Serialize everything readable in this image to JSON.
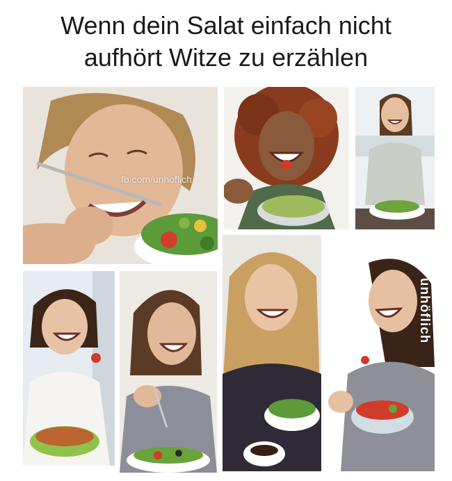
{
  "caption": {
    "line1": "Wenn dein Salat einfach nicht",
    "line2": "aufhört Witze zu erzählen"
  },
  "watermarks": {
    "url": "fb.com/unhoflich",
    "logo": "unhöflich"
  },
  "photos": [
    {
      "id": "photo-1",
      "hair": "#b08a55",
      "skin": "#e2b896",
      "top": "#f3efe9",
      "bg1": "#f1eee9",
      "bg2": "#d9d1c7"
    },
    {
      "id": "photo-2",
      "hair": "#8a3b1e",
      "skin": "#8a5a3c",
      "top": "#4f6b4a",
      "bg1": "#f4f2ef",
      "bg2": "#e0dcd6"
    },
    {
      "id": "photo-3",
      "hair": "#5a3b24",
      "skin": "#e5bfa0",
      "top": "#c9cfc6",
      "bg1": "#eef1f3",
      "bg2": "#c9d1d6"
    },
    {
      "id": "photo-4",
      "hair": "#3b2418",
      "skin": "#e8c2a4",
      "top": "#f6f4f1",
      "bg1": "#e7edf2",
      "bg2": "#c4ccd2"
    },
    {
      "id": "photo-5",
      "hair": "#5b3a26",
      "skin": "#e2b89a",
      "top": "#8c8f99",
      "bg1": "#eeeae4",
      "bg2": "#d3cbbf"
    },
    {
      "id": "photo-6",
      "hair": "#caa062",
      "skin": "#e8c4a2",
      "top": "#2f2a35",
      "bg1": "#e9e7e2",
      "bg2": "#cfcac1"
    },
    {
      "id": "photo-7",
      "hair": "#3a2418",
      "skin": "#e6c0a2",
      "top": "#8f8f98",
      "bg1": "#ffffff",
      "bg2": "#f1f1f1"
    }
  ]
}
